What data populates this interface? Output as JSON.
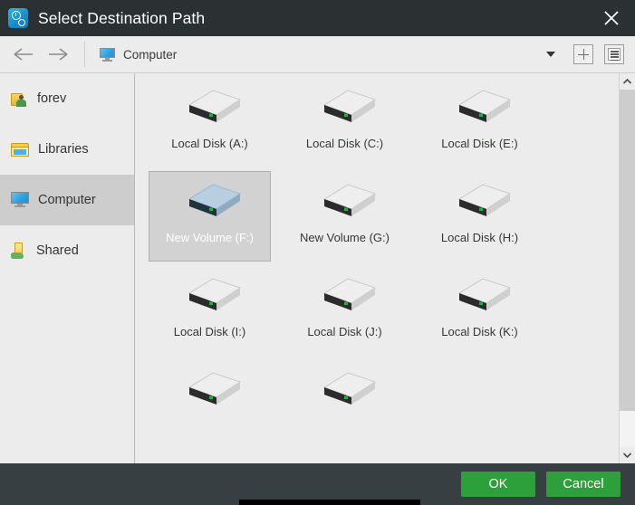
{
  "titlebar": {
    "title": "Select Destination Path",
    "app_icon": "clock-gear-icon",
    "close_icon": "close-icon"
  },
  "toolbar": {
    "back_icon": "arrow-left-icon",
    "forward_icon": "arrow-right-icon",
    "location_icon": "computer-monitor-icon",
    "location": "Computer",
    "dropdown_icon": "chevron-down-icon",
    "new_folder_icon": "plus-icon",
    "view_mode_icon": "list-view-icon"
  },
  "sidebar": {
    "items": [
      {
        "label": "forev",
        "icon": "user-folder-icon",
        "selected": false
      },
      {
        "label": "Libraries",
        "icon": "libraries-folder-icon",
        "selected": false
      },
      {
        "label": "Computer",
        "icon": "computer-monitor-icon",
        "selected": true
      },
      {
        "label": "Shared",
        "icon": "shared-folder-icon",
        "selected": false
      }
    ]
  },
  "content": {
    "rows": [
      [
        {
          "label": "Local Disk (A:)",
          "icon": "hard-drive-icon",
          "selected": false
        },
        {
          "label": "Local Disk (C:)",
          "icon": "hard-drive-icon",
          "selected": false
        },
        {
          "label": "Local Disk (E:)",
          "icon": "hard-drive-icon",
          "selected": false
        }
      ],
      [
        {
          "label": "New Volume (F:)",
          "icon": "hard-drive-icon",
          "selected": true
        },
        {
          "label": "New Volume (G:)",
          "icon": "hard-drive-icon",
          "selected": false
        },
        {
          "label": "Local Disk (H:)",
          "icon": "hard-drive-icon",
          "selected": false
        }
      ],
      [
        {
          "label": "Local Disk (I:)",
          "icon": "hard-drive-icon",
          "selected": false
        },
        {
          "label": "Local Disk (J:)",
          "icon": "hard-drive-icon",
          "selected": false
        },
        {
          "label": "Local Disk (K:)",
          "icon": "hard-drive-icon",
          "selected": false
        }
      ],
      [
        {
          "label": "",
          "icon": "hard-drive-icon",
          "selected": false
        },
        {
          "label": "",
          "icon": "hard-drive-icon",
          "selected": false
        },
        {
          "label": "",
          "icon": "",
          "selected": false
        }
      ]
    ]
  },
  "scrollbar": {
    "up_icon": "chevron-up-icon",
    "down_icon": "chevron-down-icon"
  },
  "footer": {
    "ok_label": "OK",
    "cancel_label": "Cancel"
  },
  "colors": {
    "titlebar_bg": "#2b3033",
    "footer_bg": "#383f42",
    "accent_green": "#2da03b",
    "selection_bg": "#d2d2d2",
    "sidebar_selection_bg": "#cdcdcd",
    "drive_led_green": "#22b03a",
    "selected_drive_blue": "#7ea8c8"
  }
}
